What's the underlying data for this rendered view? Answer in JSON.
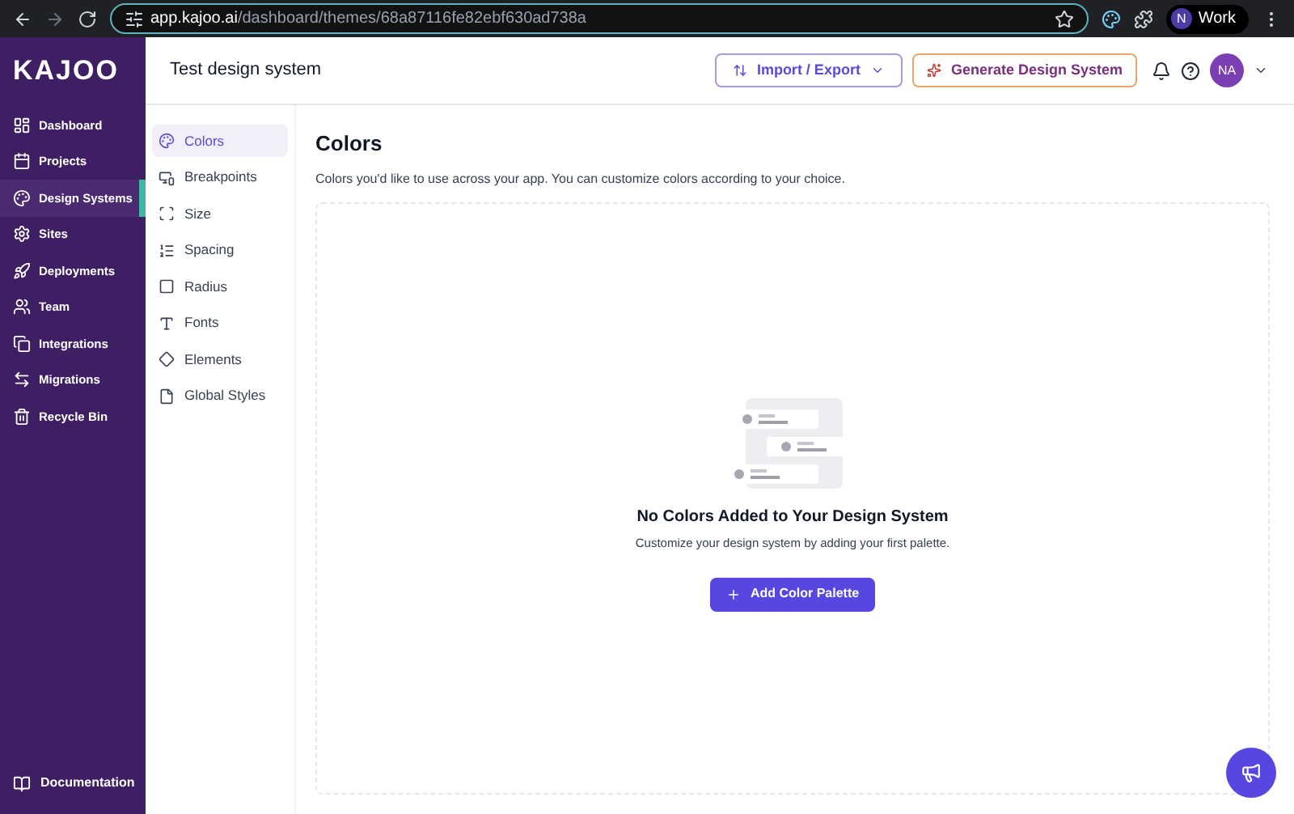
{
  "browser": {
    "url_host": "app.kajoo.ai",
    "url_path": "/dashboard/themes/68a87116fe82ebf630ad738a",
    "profile_initial": "N",
    "profile_label": "Work"
  },
  "sidebar": {
    "logo": "KAJOO",
    "items": [
      {
        "label": "Dashboard",
        "selected": false
      },
      {
        "label": "Projects",
        "selected": false
      },
      {
        "label": "Design Systems",
        "selected": true
      },
      {
        "label": "Sites",
        "selected": false
      },
      {
        "label": "Deployments",
        "selected": false
      },
      {
        "label": "Team",
        "selected": false
      },
      {
        "label": "Integrations",
        "selected": false
      },
      {
        "label": "Migrations",
        "selected": false
      },
      {
        "label": "Recycle Bin",
        "selected": false
      }
    ],
    "footer": "Documentation"
  },
  "header": {
    "title": "Test design system",
    "import_export": "Import / Export",
    "generate": "Generate Design System",
    "avatar": "NA"
  },
  "subnav": [
    {
      "label": "Colors",
      "selected": true
    },
    {
      "label": "Breakpoints",
      "selected": false
    },
    {
      "label": "Size",
      "selected": false
    },
    {
      "label": "Spacing",
      "selected": false
    },
    {
      "label": "Radius",
      "selected": false
    },
    {
      "label": "Fonts",
      "selected": false
    },
    {
      "label": "Elements",
      "selected": false
    },
    {
      "label": "Global Styles",
      "selected": false
    }
  ],
  "content": {
    "title": "Colors",
    "description": "Colors you'd like to use across your app. You can customize colors according to your choice.",
    "empty_title": "No Colors Added to Your Design System",
    "empty_text": "Customize your design system by adding your first palette.",
    "add_button": "Add Color Palette"
  }
}
